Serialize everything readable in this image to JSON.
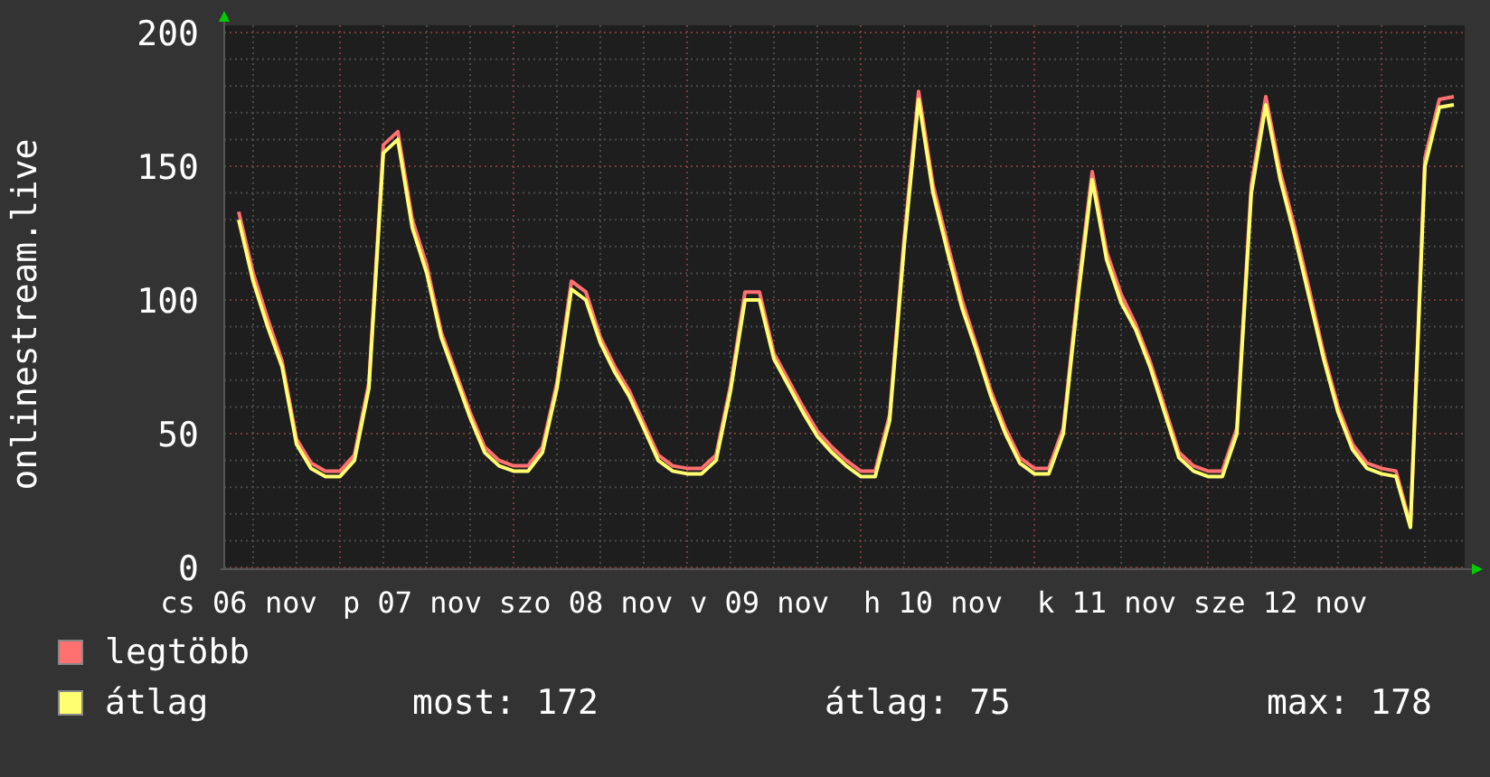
{
  "chart": {
    "chart_data": {
      "type": "line",
      "grid": true,
      "ylabel": "onlinestream.live",
      "ylim": [
        0,
        200
      ],
      "yticks": [
        0,
        50,
        100,
        150,
        200
      ],
      "categories": [
        "cs 06 nov",
        null,
        null,
        null,
        null,
        null,
        null,
        null,
        null,
        null,
        null,
        null,
        "p 07 nov",
        null,
        null,
        null,
        null,
        null,
        null,
        null,
        null,
        null,
        null,
        null,
        "szo 08 nov",
        null,
        null,
        null,
        null,
        null,
        null,
        null,
        null,
        null,
        null,
        null,
        "v 09 nov",
        null,
        null,
        null,
        null,
        null,
        null,
        null,
        null,
        null,
        null,
        null,
        "h 10 nov",
        null,
        null,
        null,
        null,
        null,
        null,
        null,
        null,
        null,
        null,
        null,
        "k 11 nov",
        null,
        null,
        null,
        null,
        null,
        null,
        null,
        null,
        null,
        null,
        null,
        "sze 12 nov",
        null,
        null,
        null,
        null,
        null,
        null,
        null,
        null,
        null,
        null,
        null,
        null
      ],
      "series": [
        {
          "name": "legtöbb",
          "color": "#ff7070",
          "values": [
            133,
            110,
            93,
            77,
            48,
            39,
            36,
            36,
            42,
            69,
            158,
            163,
            130,
            113,
            88,
            73,
            58,
            45,
            40,
            38,
            38,
            45,
            69,
            107,
            103,
            86,
            75,
            66,
            54,
            42,
            38,
            37,
            37,
            42,
            68,
            103,
            103,
            80,
            70,
            60,
            51,
            45,
            40,
            36,
            36,
            57,
            123,
            178,
            143,
            121,
            100,
            83,
            66,
            52,
            41,
            37,
            37,
            52,
            103,
            148,
            118,
            102,
            91,
            77,
            60,
            43,
            38,
            36,
            36,
            52,
            143,
            176,
            148,
            127,
            104,
            80,
            60,
            46,
            39,
            37,
            36,
            16,
            153,
            175,
            176
          ]
        },
        {
          "name": "átlag",
          "color": "#ffff70",
          "values": [
            130,
            107,
            90,
            75,
            46,
            37,
            34,
            34,
            40,
            67,
            155,
            160,
            127,
            110,
            86,
            71,
            56,
            43,
            38,
            36,
            36,
            43,
            67,
            104,
            100,
            84,
            73,
            64,
            52,
            40,
            36,
            35,
            35,
            40,
            66,
            100,
            100,
            78,
            68,
            58,
            49,
            43,
            38,
            34,
            34,
            55,
            120,
            175,
            140,
            118,
            97,
            81,
            64,
            50,
            39,
            35,
            35,
            50,
            100,
            145,
            115,
            99,
            89,
            75,
            58,
            41,
            36,
            34,
            34,
            50,
            140,
            173,
            145,
            124,
            101,
            78,
            58,
            44,
            37,
            35,
            34,
            15,
            150,
            172,
            173
          ]
        }
      ]
    }
  },
  "legend_stats": [
    "most: 172",
    "átlag: 75",
    "max: 178"
  ]
}
